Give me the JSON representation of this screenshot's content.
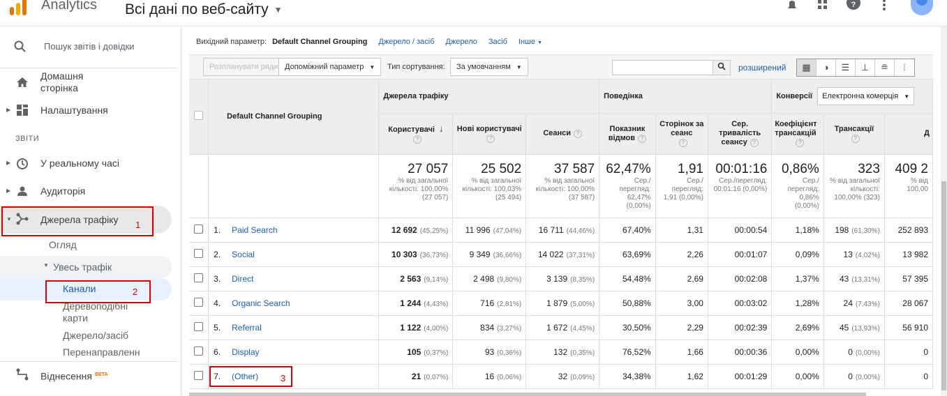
{
  "app": {
    "name": "Analytics",
    "property": "Всі дані по веб-сайту"
  },
  "sidebar": {
    "search_label": "Пошук звітів і довідки",
    "home": "Домашня сторінка",
    "settings": "Налаштування",
    "section_reports": "ЗВІТИ",
    "realtime": "У реальному часі",
    "audience": "Аудиторія",
    "acquisition": "Джерела трафіку",
    "overview": "Огляд",
    "all_traffic": "Увесь трафік",
    "channels": "Канали",
    "treemaps": "Деревоподібні карти",
    "source_medium": "Джерело/засіб",
    "referrals": "Перенаправленн",
    "attribution": "Віднесення",
    "beta": "BETA",
    "annotations": [
      "1",
      "2",
      "3"
    ]
  },
  "dims": {
    "label": "Вихідний параметр:",
    "current": "Default Channel Grouping",
    "links": [
      "Джерело / засіб",
      "Джерело",
      "Засіб",
      "Інше"
    ]
  },
  "toolbar": {
    "plot_rows": "Розпланувати ряди",
    "secondary": "Допоміжний параметр",
    "sort_label": "Тип сортування:",
    "sort_value": "За умовчанням",
    "advanced": "розширений"
  },
  "table": {
    "groups": {
      "acquisition": "Джерела трафіку",
      "behavior": "Поведінка",
      "conversions": "Конверсії",
      "ecommerce": "Електронна комерція"
    },
    "dim_header": "Default Channel Grouping",
    "columns": [
      "Користувачі",
      "Нові користувачі",
      "Сеанси",
      "Показник відмов",
      "Сторінок за сеанс",
      "Сер. тривалість сеансу",
      "Коефіцієнт трансакцій",
      "Трансакції",
      "Д"
    ],
    "totals": [
      {
        "big": "27 057",
        "sub": "% від загальної кількості: 100,00% (27 057)"
      },
      {
        "big": "25 502",
        "sub": "% від загальної кількості: 100,03% (25 494)"
      },
      {
        "big": "37 587",
        "sub": "% від загальної кількості: 100,00% (37 587)"
      },
      {
        "big": "62,47%",
        "sub": "Сер./ перегляд: 62,47% (0,00%)"
      },
      {
        "big": "1,91",
        "sub": "Сер./ перегляд: 1,91 (0,00%)"
      },
      {
        "big": "00:01:16",
        "sub": "Сер./перегляд: 00:01:16 (0,00%)"
      },
      {
        "big": "0,86%",
        "sub": "Сер./ перегляд: 0,86% (0,00%)"
      },
      {
        "big": "323",
        "sub": "% від загальної кількості: 100,00% (323)"
      },
      {
        "big": "409 2",
        "sub": "% від 100,00"
      }
    ],
    "rows": [
      {
        "idx": "1.",
        "name": "Paid Search",
        "users": "12 692",
        "users_pct": "(45,25%)",
        "new": "11 996",
        "new_pct": "(47,04%)",
        "sessions": "16 711",
        "sessions_pct": "(44,46%)",
        "bounce": "67,40%",
        "pps": "1,31",
        "dur": "00:00:54",
        "conv": "1,18%",
        "trans": "198",
        "trans_pct": "(61,30%)",
        "rev": "252 893"
      },
      {
        "idx": "2.",
        "name": "Social",
        "users": "10 303",
        "users_pct": "(36,73%)",
        "new": "9 349",
        "new_pct": "(36,66%)",
        "sessions": "14 022",
        "sessions_pct": "(37,31%)",
        "bounce": "63,69%",
        "pps": "2,26",
        "dur": "00:01:07",
        "conv": "0,09%",
        "trans": "13",
        "trans_pct": "(4,02%)",
        "rev": "13 982"
      },
      {
        "idx": "3.",
        "name": "Direct",
        "users": "2 563",
        "users_pct": "(9,14%)",
        "new": "2 498",
        "new_pct": "(9,80%)",
        "sessions": "3 139",
        "sessions_pct": "(8,35%)",
        "bounce": "54,48%",
        "pps": "2,69",
        "dur": "00:02:08",
        "conv": "1,37%",
        "trans": "43",
        "trans_pct": "(13,31%)",
        "rev": "57 395"
      },
      {
        "idx": "4.",
        "name": "Organic Search",
        "users": "1 244",
        "users_pct": "(4,43%)",
        "new": "716",
        "new_pct": "(2,81%)",
        "sessions": "1 879",
        "sessions_pct": "(5,00%)",
        "bounce": "50,88%",
        "pps": "3,00",
        "dur": "00:03:02",
        "conv": "1,28%",
        "trans": "24",
        "trans_pct": "(7,43%)",
        "rev": "28 067"
      },
      {
        "idx": "5.",
        "name": "Referral",
        "users": "1 122",
        "users_pct": "(4,00%)",
        "new": "834",
        "new_pct": "(3,27%)",
        "sessions": "1 672",
        "sessions_pct": "(4,45%)",
        "bounce": "30,50%",
        "pps": "2,29",
        "dur": "00:02:39",
        "conv": "2,69%",
        "trans": "45",
        "trans_pct": "(13,93%)",
        "rev": "56 910"
      },
      {
        "idx": "6.",
        "name": "Display",
        "users": "105",
        "users_pct": "(0,37%)",
        "new": "93",
        "new_pct": "(0,36%)",
        "sessions": "132",
        "sessions_pct": "(0,35%)",
        "bounce": "76,52%",
        "pps": "1,66",
        "dur": "00:00:36",
        "conv": "0,00%",
        "trans": "0",
        "trans_pct": "(0,00%)",
        "rev": "0"
      },
      {
        "idx": "7.",
        "name": "(Other)",
        "users": "21",
        "users_pct": "(0,07%)",
        "new": "16",
        "new_pct": "(0,06%)",
        "sessions": "32",
        "sessions_pct": "(0,09%)",
        "bounce": "34,38%",
        "pps": "1,62",
        "dur": "00:01:29",
        "conv": "0,00%",
        "trans": "0",
        "trans_pct": "(0,00%)",
        "rev": "0"
      }
    ]
  }
}
